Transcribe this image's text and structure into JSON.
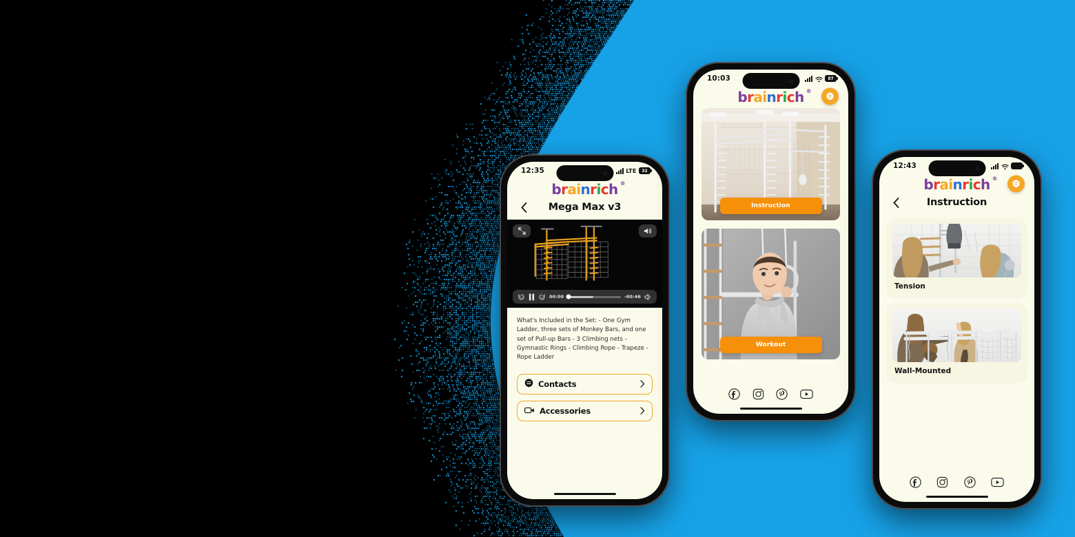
{
  "background": {
    "blue": "#17A2E8",
    "black": "#000000",
    "cream": "#FBFBEB",
    "accent_orange": "#F5A623",
    "cta_orange": "#F79009"
  },
  "brand": {
    "wordmark": "brainrich",
    "letters": [
      "b",
      "r",
      "a",
      "i",
      "n",
      "r",
      "i",
      "c",
      "h"
    ],
    "registered_mark": "®"
  },
  "phones": [
    {
      "id": "phone-left",
      "status": {
        "time": "12:35",
        "network": "LTE",
        "battery": "32",
        "signal_icon": "signal-bars-icon",
        "wifi_icon": null
      },
      "nav": {
        "back_icon": "chevron-left-icon",
        "title": "Mega Max v3"
      },
      "video": {
        "fullscreen_icon": "expand-icon",
        "volume_icon": "speaker-icon",
        "rewind_icon": "rewind-15-icon",
        "play_pause_icon": "pause-icon",
        "forward_icon": "forward-15-icon",
        "current_time": "00:00",
        "remaining_time": "-00:46",
        "mute_icon": "audio-toggle-icon",
        "progress_percent": 4
      },
      "description": "What's Included in the Set:  - One Gym Ladder, three sets of Monkey Bars, and one set of Pull-up Bars  - 3 Climbing nets  - Gymnastic Rings  - Climbing Rope  - Trapeze  - Rope Ladder",
      "buttons": [
        {
          "label": "Contacts",
          "icon": "chat-bubble-icon",
          "chevron": "chevron-right-icon"
        },
        {
          "label": "Accessories",
          "icon": "video-camera-icon",
          "chevron": "chevron-right-icon"
        }
      ]
    },
    {
      "id": "phone-mid",
      "status": {
        "time": "10:03",
        "network": null,
        "battery": "87",
        "signal_icon": "signal-bars-icon",
        "wifi_icon": "wifi-icon"
      },
      "chat_fab_icon": "chat-bubble-icon",
      "cards": [
        {
          "name": "gym-photo-card",
          "cta_label": "Instruction",
          "alt": "white wall-mounted gym set in a room"
        },
        {
          "name": "kid-photo-card",
          "cta_label": "Workout",
          "alt": "boy in grey hoodie holding gymnastic rings"
        }
      ],
      "social": [
        {
          "name": "facebook-icon",
          "label": "Facebook"
        },
        {
          "name": "instagram-icon",
          "label": "Instagram"
        },
        {
          "name": "pinterest-icon",
          "label": "Pinterest"
        },
        {
          "name": "youtube-icon",
          "label": "YouTube"
        }
      ]
    },
    {
      "id": "phone-right",
      "status": {
        "time": "12:43",
        "network": null,
        "battery": "",
        "signal_icon": "signal-bars-icon",
        "wifi_icon": "wifi-icon"
      },
      "chat_fab_icon": "chat-bubble-icon",
      "nav": {
        "back_icon": "chevron-left-icon",
        "title": "Instruction"
      },
      "cards": [
        {
          "caption": "Tension",
          "alt": "woman adjusting tension on a gym set with a girl"
        },
        {
          "caption": "Wall-Mounted",
          "alt": "woman and children at a wall-mounted gym set"
        }
      ],
      "social": [
        {
          "name": "facebook-icon",
          "label": "Facebook"
        },
        {
          "name": "instagram-icon",
          "label": "Instagram"
        },
        {
          "name": "pinterest-icon",
          "label": "Pinterest"
        },
        {
          "name": "youtube-icon",
          "label": "YouTube"
        }
      ]
    }
  ]
}
